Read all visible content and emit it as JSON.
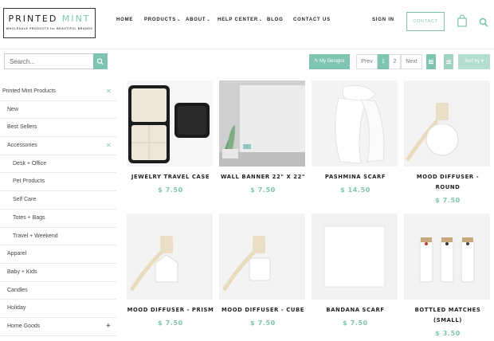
{
  "brand": {
    "logo_left": "PRINTED",
    "logo_right": "MINT",
    "tagline": "WHOLESALE PRODUCTS for BEAUTIFUL BRANDS"
  },
  "nav": {
    "home": "HOME",
    "products": "PRODUCTS",
    "about": "ABOUT",
    "help": "HELP CENTER",
    "blog": "BLOG",
    "contact_us": "CONTACT US",
    "sign_in": "SIGN IN",
    "contact_button": "CONTACT"
  },
  "toolbar": {
    "search_placeholder": "Search...",
    "my_designs": "My Designs",
    "prev": "Prev",
    "page1": "1",
    "page2": "2",
    "next": "Next",
    "sort_by": "Sort by"
  },
  "sidebar": {
    "root": "Printed Mint Products",
    "items": [
      "New",
      "Best Sellers",
      "Accessories",
      "Desk + Office",
      "Pet Products",
      "Self Care",
      "Totes + Bags",
      "Travel + Weekend",
      "Apparel",
      "Baby + Kids",
      "Candles",
      "Holiday",
      "Home Goods"
    ]
  },
  "products": [
    {
      "name": "JEWELRY TRAVEL CASE",
      "price": "$ 7.50"
    },
    {
      "name": "WALL BANNER 22\" X 22\"",
      "price": "$ 7.50"
    },
    {
      "name": "PASHMINA SCARF",
      "price": "$ 14.50"
    },
    {
      "name": "MOOD DIFFUSER - ROUND",
      "price": "$ 7.50"
    },
    {
      "name": "MOOD DIFFUSER - PRISM",
      "price": "$ 7.50"
    },
    {
      "name": "MOOD DIFFUSER - CUBE",
      "price": "$ 7.50"
    },
    {
      "name": "BANDANA SCARF",
      "price": "$ 7.50"
    },
    {
      "name": "BOTTLED MATCHES (SMALL)",
      "price": "$ 3.50"
    }
  ],
  "colors": {
    "accent": "#7fc4b0",
    "text": "#222222"
  }
}
